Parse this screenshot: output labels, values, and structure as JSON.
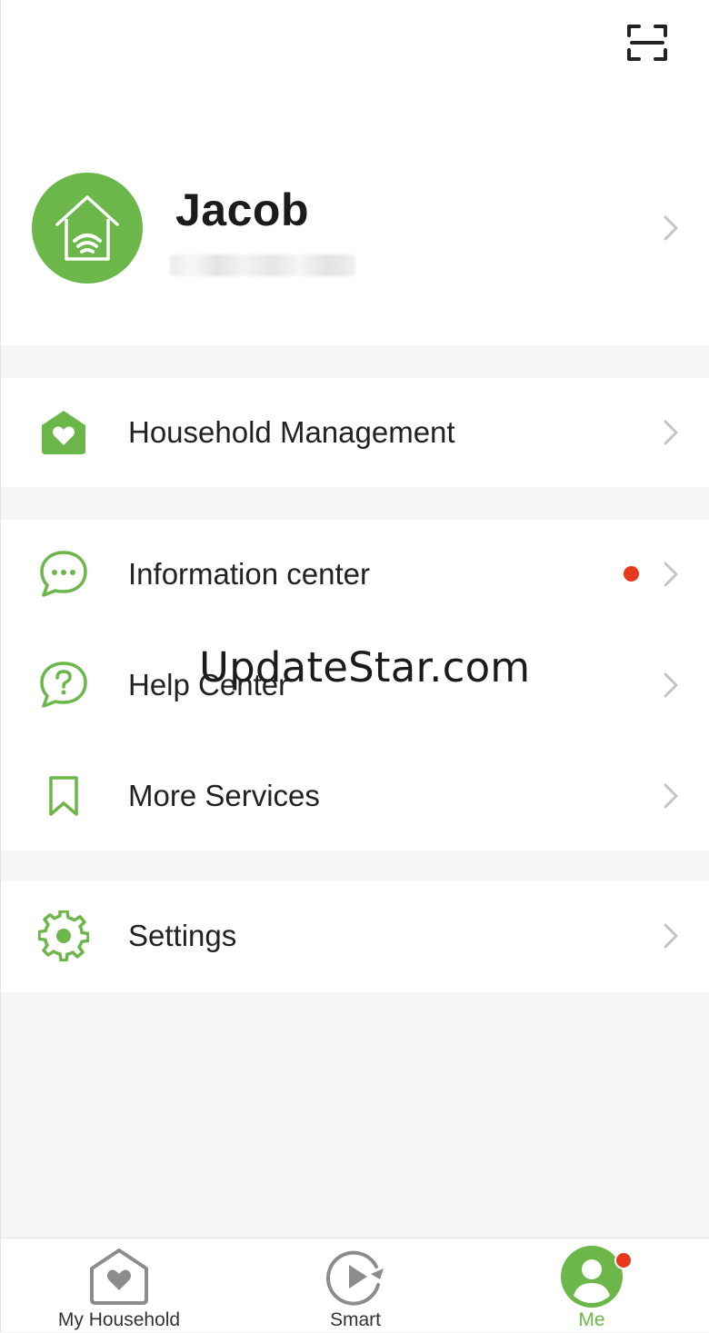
{
  "header": {
    "scan_icon": "scan-icon"
  },
  "profile": {
    "name": "Jacob",
    "id_text": "",
    "avatar_icon": "smart-home-icon"
  },
  "menu": {
    "household": {
      "label": "Household Management",
      "icon": "home-heart-icon"
    },
    "information": {
      "label": "Information center",
      "icon": "chat-bubble-icon",
      "has_notification": true
    },
    "help": {
      "label": "Help Center",
      "icon": "question-bubble-icon"
    },
    "services": {
      "label": "More Services",
      "icon": "bookmark-icon"
    },
    "settings": {
      "label": "Settings",
      "icon": "gear-icon"
    }
  },
  "watermark": {
    "text": "UpdateStar.com"
  },
  "tabs": [
    {
      "label": "My Household",
      "icon": "household-heart-icon",
      "active": false
    },
    {
      "label": "Smart",
      "icon": "smart-play-icon",
      "active": false
    },
    {
      "label": "Me",
      "icon": "user-icon",
      "active": true,
      "badge": true
    }
  ],
  "colors": {
    "accent": "#6bb749",
    "notification": "#e8391c",
    "background": "#f6f6f6",
    "surface": "#ffffff",
    "text": "#222222"
  }
}
